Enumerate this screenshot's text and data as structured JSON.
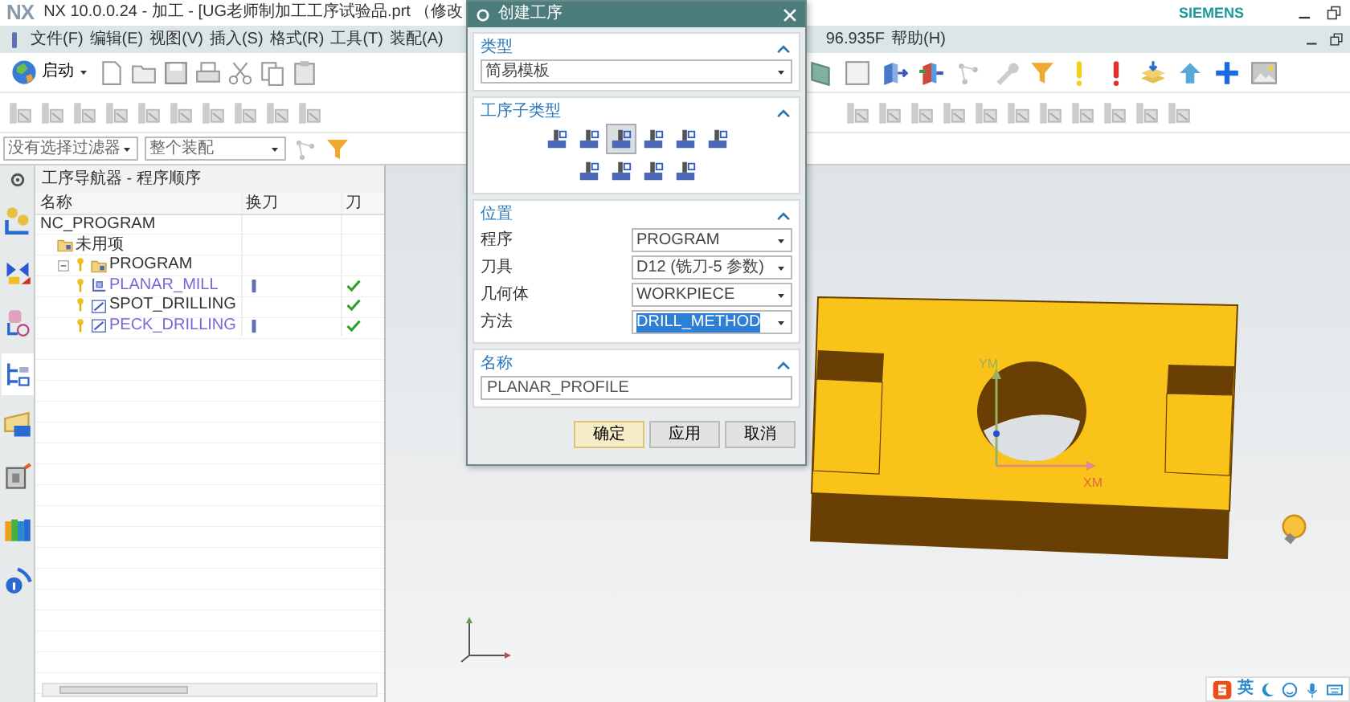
{
  "window": {
    "logo": "NX",
    "title": "NX 10.0.0.24 - 加工 - [UG老师制加工工序试验品.prt （修改",
    "brand": "SIEMENS"
  },
  "menu": [
    "文件(F)",
    "编辑(E)",
    "视图(V)",
    "插入(S)",
    "格式(R)",
    "工具(T)",
    "装配(A)"
  ],
  "menu_right": [
    "96.935F",
    "帮助(H)"
  ],
  "start_button": "启动",
  "filters": [
    "没有选择过滤器",
    "整个装配"
  ],
  "resource_bar": [
    {
      "selected": false
    },
    {
      "selected": false
    },
    {
      "selected": false
    },
    {
      "selected": true
    },
    {
      "selected": false
    },
    {
      "selected": false
    },
    {
      "selected": false
    },
    {
      "selected": false
    }
  ],
  "navigator": {
    "title": "工序导航器 - 程序顺序",
    "columns": [
      "名称",
      "换刀",
      "刀"
    ],
    "tree": [
      {
        "name": "NC_PROGRAM",
        "children": [
          {
            "name": "未用项",
            "kind": "group"
          },
          {
            "name": "PROGRAM",
            "kind": "group",
            "expanded": true,
            "children": [
              {
                "name": "PLANAR_MILL",
                "kind": "operation",
                "color": "#7a67d6",
                "tool_change": true,
                "toolpath_ok": true
              },
              {
                "name": "SPOT_DRILLING",
                "kind": "operation",
                "color": "#333333",
                "tool_change": false,
                "toolpath_ok": true
              },
              {
                "name": "PECK_DRILLING",
                "kind": "operation",
                "color": "#7a67d6",
                "tool_change": true,
                "toolpath_ok": true
              }
            ]
          }
        ]
      }
    ]
  },
  "dialog": {
    "title": "创建工序",
    "sections": [
      {
        "kind": "dropdown",
        "title": "类型",
        "expanded": true,
        "value": "简易模板"
      },
      {
        "kind": "icons",
        "title": "工序子类型",
        "expanded": true,
        "subtypes": [
          {
            "selected": false
          },
          {
            "selected": false
          },
          {
            "selected": true
          },
          {
            "selected": false
          },
          {
            "selected": false
          },
          {
            "selected": false
          },
          {
            "selected": false
          },
          {
            "selected": false
          },
          {
            "selected": false
          },
          {
            "selected": false
          }
        ]
      },
      {
        "kind": "fields",
        "title": "位置",
        "expanded": true,
        "fields": [
          {
            "label": "程序",
            "value": "PROGRAM",
            "highlighted": false
          },
          {
            "label": "刀具",
            "value": "D12 (铣刀-5 参数)",
            "highlighted": false
          },
          {
            "label": "几何体",
            "value": "WORKPIECE",
            "highlighted": false
          },
          {
            "label": "方法",
            "value": "DRILL_METHOD",
            "highlighted": true
          }
        ]
      },
      {
        "kind": "text",
        "title": "名称",
        "expanded": true,
        "value": "PLANAR_PROFILE"
      }
    ],
    "buttons": [
      {
        "label": "确定",
        "focused": true
      },
      {
        "label": "应用",
        "focused": false
      },
      {
        "label": "取消",
        "focused": false
      }
    ]
  },
  "viewport": {
    "axis_labels": [
      "YM",
      "XM"
    ]
  },
  "ime": {
    "label": "英"
  }
}
